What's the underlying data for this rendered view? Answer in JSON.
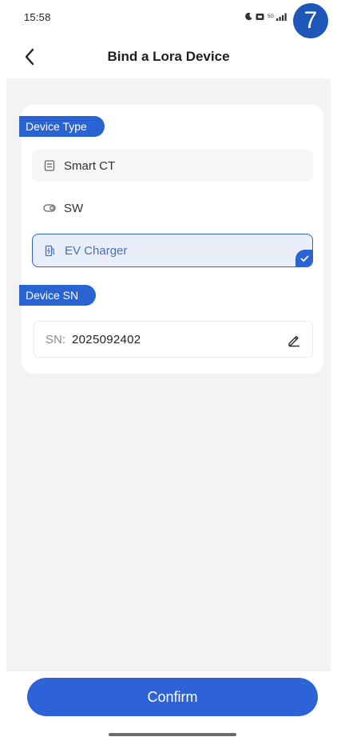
{
  "status_bar": {
    "time": "15:58",
    "icons": [
      "moon-icon",
      "battery-saver-icon",
      "5g-icon",
      "signal-icon"
    ],
    "network_label": "5G"
  },
  "step_badge": "7",
  "header": {
    "title": "Bind a Lora Device",
    "back_icon": "chevron-left-icon"
  },
  "device_type": {
    "section_label": "Device Type",
    "options": [
      {
        "label": "Smart CT",
        "icon": "meter-icon",
        "selected": false
      },
      {
        "label": "SW",
        "icon": "toggle-icon",
        "selected": false
      },
      {
        "label": "EV Charger",
        "icon": "ev-charger-icon",
        "selected": true
      }
    ]
  },
  "device_sn": {
    "section_label": "Device SN",
    "field_label": "SN:",
    "value": "2025092402",
    "edit_icon": "pencil-icon"
  },
  "footer": {
    "confirm_label": "Confirm"
  },
  "colors": {
    "accent": "#2a64d3",
    "badge": "#1f57b8",
    "background": "#f3f3f3",
    "selected_bg": "#e9eef9"
  }
}
